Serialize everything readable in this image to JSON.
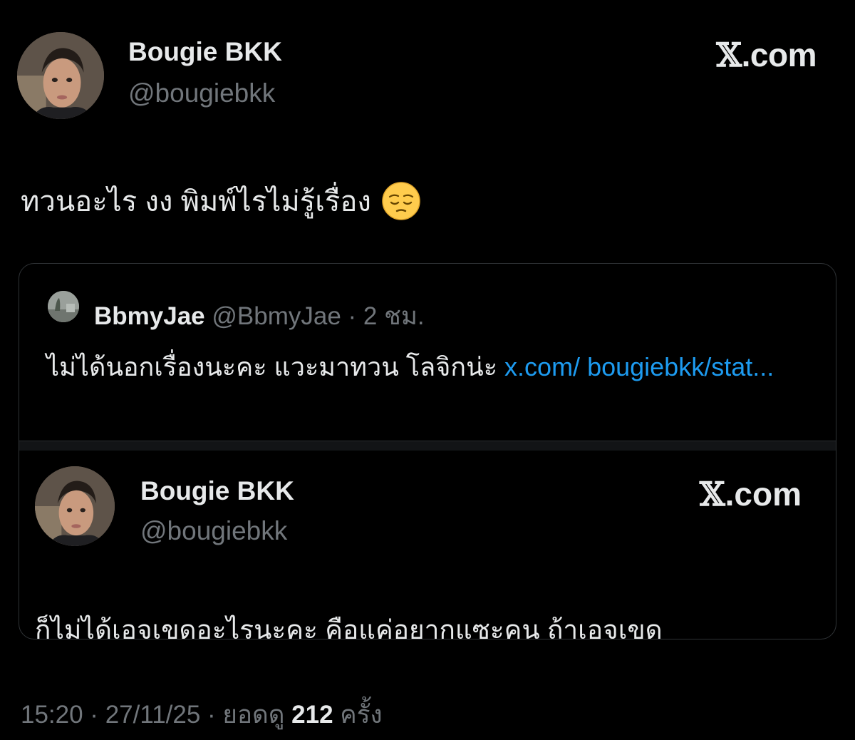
{
  "author": {
    "display_name": "Bougie BKK",
    "handle": "@bougiebkk",
    "avatar_icon": "profile-photo-avatar"
  },
  "brand": {
    "mark": "𝕏",
    "domain": ".com"
  },
  "tweet": {
    "text": "ทวนอะไร งง พิมพ์ไรไม่รู้เรื่อง",
    "emoji_icon": "pensive-face-emoji"
  },
  "quote": {
    "author_name": "BbmyJae",
    "meta": " @BbmyJae · 2 ชม.",
    "text": "ไม่ได้นอกเรื่องนะคะ แวะมาทวน โลจิกน่ะ ",
    "link_text": "x.com/ bougiebkk/stat...",
    "embedded": {
      "display_name": "Bougie BKK",
      "handle": "@bougiebkk",
      "brand_mark": "𝕏",
      "brand_domain": ".com",
      "text": "ก็ไม่ได้เอจเขดอะไรนะคะ คือแค่อยากแซะคน ถ้าเอจเขด"
    }
  },
  "footer": {
    "time_date": "15:20 · 27/11/25 · ยอดดู ",
    "views": "212",
    "views_suffix": " ครั้ง"
  },
  "colors": {
    "background": "#000000",
    "text_primary": "#e7e9ea",
    "text_secondary": "#71767b",
    "link": "#1d9bf0",
    "border": "#2f3336"
  }
}
